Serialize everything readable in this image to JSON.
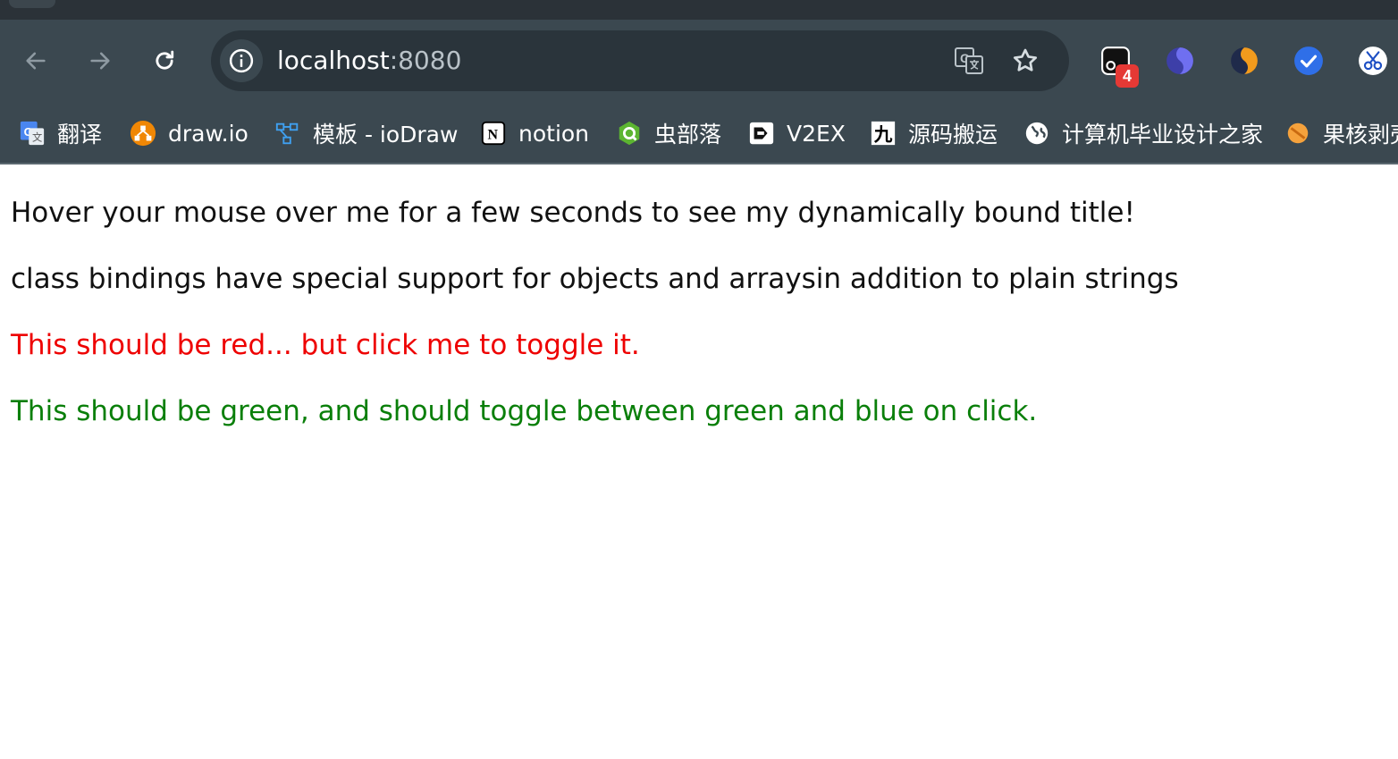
{
  "browser": {
    "address": {
      "host": "localhost",
      "port": ":8080"
    },
    "extensions": {
      "badge_count": "4"
    },
    "bookmarks": [
      {
        "label": "翻译",
        "icon": "google-translate-icon"
      },
      {
        "label": "draw.io",
        "icon": "drawio-icon"
      },
      {
        "label": "模板 - ioDraw",
        "icon": "iodraw-icon"
      },
      {
        "label": "notion",
        "icon": "notion-icon"
      },
      {
        "label": "虫部落",
        "icon": "chongbuluo-icon"
      },
      {
        "label": "V2EX",
        "icon": "v2ex-icon"
      },
      {
        "label": "源码搬运",
        "icon": "yuanma-icon"
      },
      {
        "label": "计算机毕业设计之家",
        "icon": "globe-icon"
      },
      {
        "label": "果核剥壳",
        "icon": "guohe-icon"
      }
    ]
  },
  "page": {
    "hover_text": "Hover your mouse over me for a few seconds to see my dynamically bound title!",
    "class_bindings_text": "class bindings have special support for objects and arraysin addition to plain strings",
    "red_text": "This should be red... but click me to toggle it.",
    "green_text": "This should be green, and should toggle between green and blue on click."
  },
  "colors": {
    "toolbar": "#3b4850",
    "tabstrip": "#2b3238",
    "red": "#ee0000",
    "green": "#0a7f0a"
  }
}
